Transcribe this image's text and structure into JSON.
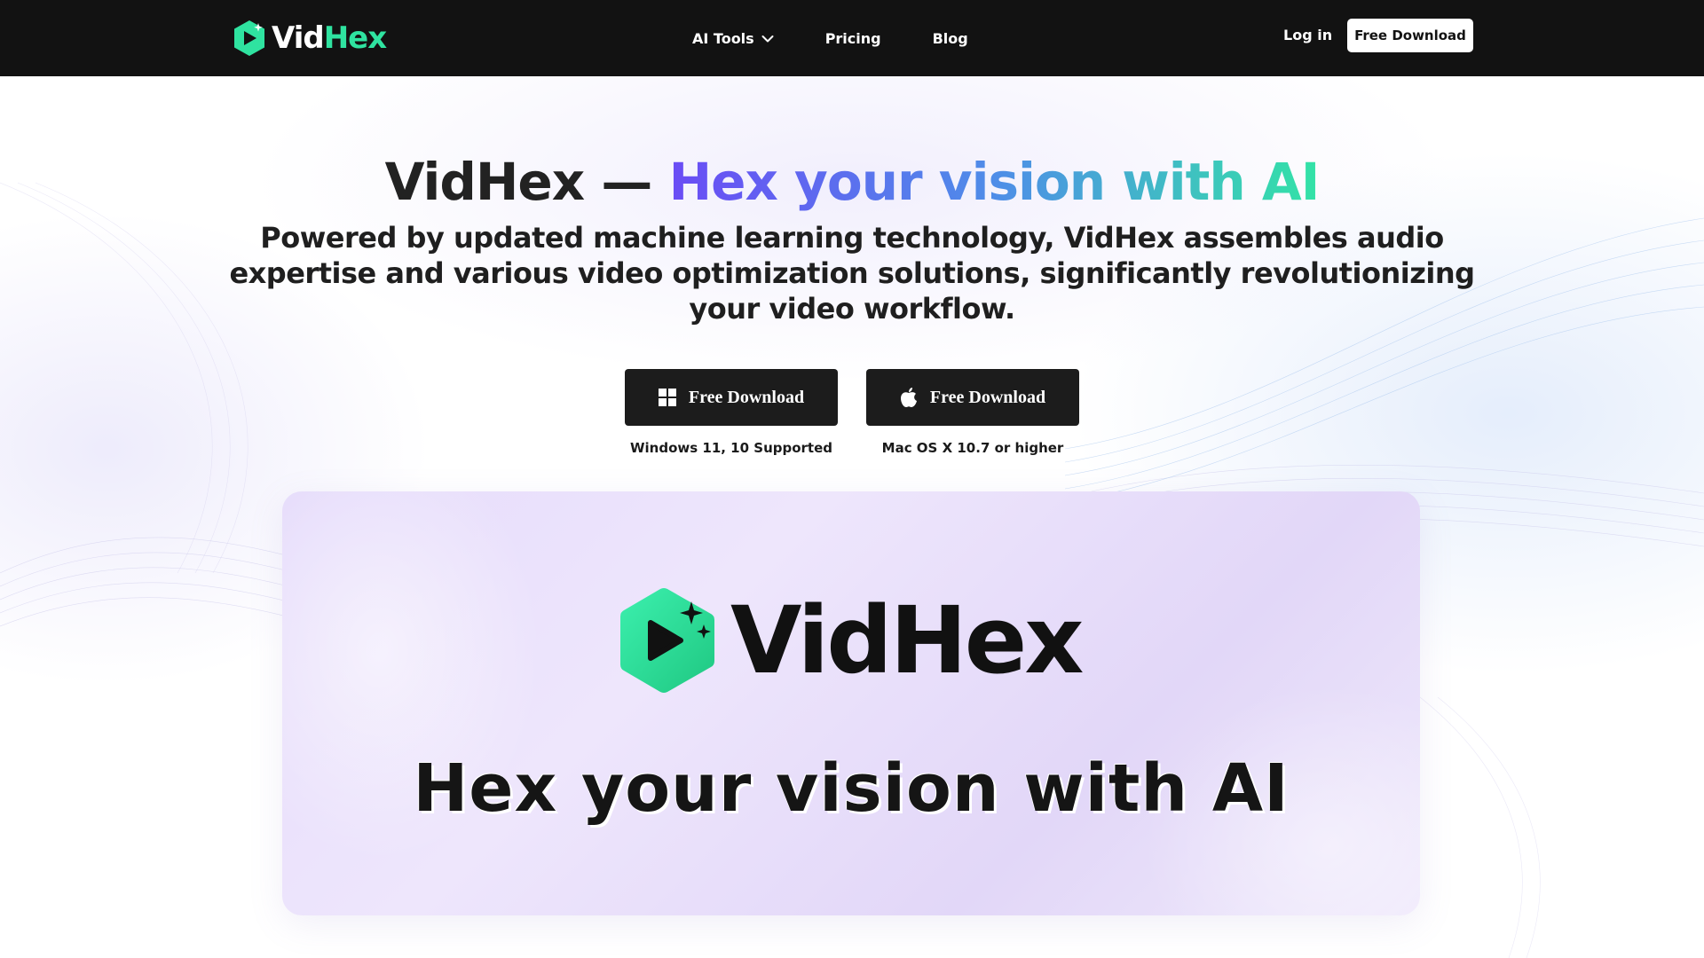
{
  "brand": {
    "logo_part1": "Vid",
    "logo_part2": "Hex",
    "accent": "#2fe3a0",
    "nav_bg": "#121212"
  },
  "nav": {
    "items": [
      {
        "label": "AI Tools",
        "has_dropdown": true
      },
      {
        "label": "Pricing",
        "has_dropdown": false
      },
      {
        "label": "Blog",
        "has_dropdown": false
      }
    ],
    "login": "Log in",
    "cta": "Free Download"
  },
  "hero": {
    "title_plain": "VidHex — ",
    "title_gradient": "Hex your vision with AI",
    "subtitle": "Powered by updated machine learning technology, VidHex assembles audio expertise and various video optimization solutions, significantly revolutionizing your video workflow.",
    "downloads": [
      {
        "label": "Free Download",
        "icon": "windows-icon",
        "note": "Windows 11, 10 Supported"
      },
      {
        "label": "Free Download",
        "icon": "apple-icon",
        "note": "Mac OS X 10.7 or higher"
      }
    ]
  },
  "showcase": {
    "logo_text": "VidHex",
    "tagline": "Hex your vision with AI"
  }
}
